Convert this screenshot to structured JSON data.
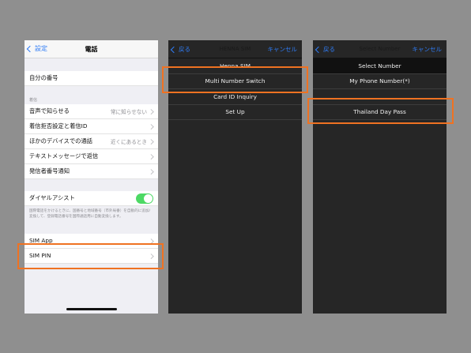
{
  "screen1": {
    "back_label": "設定",
    "title": "電話",
    "my_number_label": "自分の番号",
    "section_call": "着信",
    "rows": [
      {
        "label": "音声で知らせる",
        "value": "常に知らせない"
      },
      {
        "label": "着信拒否設定と着信ID",
        "value": ""
      },
      {
        "label": "ほかのデバイスでの通話",
        "value": "近くにあるとき"
      },
      {
        "label": "テキストメッセージで返信",
        "value": ""
      },
      {
        "label": "発信者番号通知",
        "value": ""
      }
    ],
    "dial_assist_label": "ダイヤルアシスト",
    "dial_assist_on": true,
    "dial_assist_note": "国際電話をかけるときに、国番号と地域番号（市外局番）を自動的に追加/変換して、登録電話番号を国際通話用に自動変換します。",
    "sim_app_label": "SIM App",
    "sim_pin_label": "SIM PIN"
  },
  "screen2": {
    "back_label": "戻る",
    "title": "HENNA SIM",
    "cancel_label": "キャンセル",
    "items": [
      "Henna SIM",
      "Multi Number Switch",
      "Card ID Inquiry",
      "Set Up"
    ]
  },
  "screen3": {
    "back_label": "戻る",
    "title": "Select Number",
    "cancel_label": "キャンセル",
    "items": [
      "Select Number",
      "My Phone Number(*)",
      "",
      "Thailand Day Pass"
    ]
  },
  "colors": {
    "highlight": "#ef7222",
    "ios_blue": "#2f7cf6",
    "toggle_green": "#4cd964"
  }
}
